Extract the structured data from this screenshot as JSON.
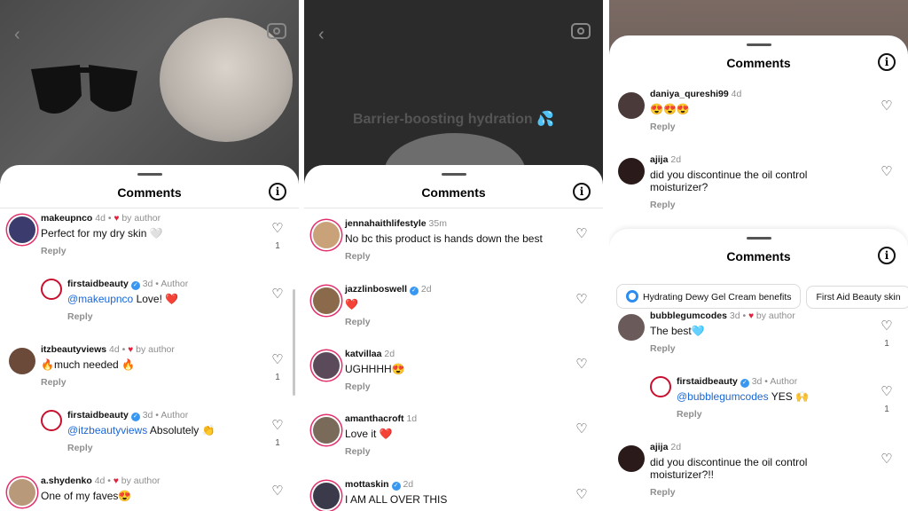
{
  "panel1": {
    "title": "Comments",
    "info_icon": "info-icon",
    "comments": [
      {
        "user": "makeupnco",
        "time": "4d",
        "by_author": "by author",
        "text": "Perfect for my dry skin 🤍",
        "reply": "Reply",
        "likes": "1",
        "avatar_color": "#3b3b6d"
      },
      {
        "user": "firstaidbeauty",
        "time": "3d",
        "author_tag": "Author",
        "mention": "@makeupnco",
        "text": " Love! ❤️",
        "reply": "Reply",
        "likes": "",
        "avatar_color": "#c8102e"
      },
      {
        "user": "itzbeautyviews",
        "time": "4d",
        "by_author": "by author",
        "text": "🔥much needed 🔥",
        "reply": "Reply",
        "likes": "1",
        "avatar_color": "#6b4a3a"
      },
      {
        "user": "firstaidbeauty",
        "time": "3d",
        "author_tag": "Author",
        "mention": "@itzbeautyviews",
        "text": " Absolutely 👏",
        "reply": "Reply",
        "likes": "1",
        "avatar_color": "#c8102e"
      },
      {
        "user": "a.shydenko",
        "time": "4d",
        "by_author": "by author",
        "text": "One of my faves😍",
        "reply": "",
        "likes": "",
        "avatar_color": "#b89a7a"
      }
    ]
  },
  "panel2": {
    "title": "Comments",
    "overlay": "Barrier-boosting hydration 💦",
    "comments": [
      {
        "user": "jennahaithlifestyle",
        "time": "35m",
        "text": "No bc this product is hands down the best",
        "reply": "Reply",
        "avatar_color": "#c9a27a"
      },
      {
        "user": "jazzlinboswell",
        "time": "2d",
        "text": "❤️",
        "reply": "Reply",
        "avatar_color": "#8a6a4a"
      },
      {
        "user": "katvillaa",
        "time": "2d",
        "text": "UGHHHH😍",
        "reply": "Reply",
        "avatar_color": "#5a4a5a"
      },
      {
        "user": "amanthacroft",
        "time": "1d",
        "text": "Love it ❤️",
        "reply": "Reply",
        "avatar_color": "#7a6a5a"
      },
      {
        "user": "mottaskin",
        "time": "2d",
        "text": "I AM ALL OVER THIS",
        "reply": "",
        "avatar_color": "#3a3a4a"
      }
    ]
  },
  "panel3": {
    "sheet_a": {
      "title": "Comments",
      "comments": [
        {
          "user": "daniya_qureshi99",
          "time": "4d",
          "text": "😍😍😍",
          "reply": "Reply",
          "avatar_color": "#4a3a3a"
        },
        {
          "user": "ajija",
          "time": "2d",
          "text": "did you discontinue the oil control moisturizer?",
          "reply": "Reply",
          "avatar_color": "#2a1a1a"
        }
      ]
    },
    "sheet_b": {
      "title": "Comments",
      "chips": [
        "Hydrating Dewy Gel Cream benefits",
        "First Aid Beauty skin"
      ],
      "comments": [
        {
          "user": "bubblegumcodes",
          "time": "3d",
          "by_author": "by author",
          "text": "The best🩵",
          "reply": "Reply",
          "likes": "1",
          "avatar_color": "#6a5a5a"
        },
        {
          "user": "firstaidbeauty",
          "time": "3d",
          "author_tag": "Author",
          "mention": "@bubblegumcodes",
          "text": " YES 🙌",
          "reply": "Reply",
          "likes": "1",
          "avatar_color": "#c8102e"
        },
        {
          "user": "ajija",
          "time": "2d",
          "text": "did you discontinue the oil control moisturizer?!!",
          "reply": "Reply",
          "likes": "",
          "avatar_color": "#2a1a1a"
        }
      ]
    }
  },
  "icons": {
    "heart": "heart-outline-icon",
    "back": "back-arrow-icon",
    "camera": "camera-icon",
    "verified": "verified-badge-icon"
  }
}
